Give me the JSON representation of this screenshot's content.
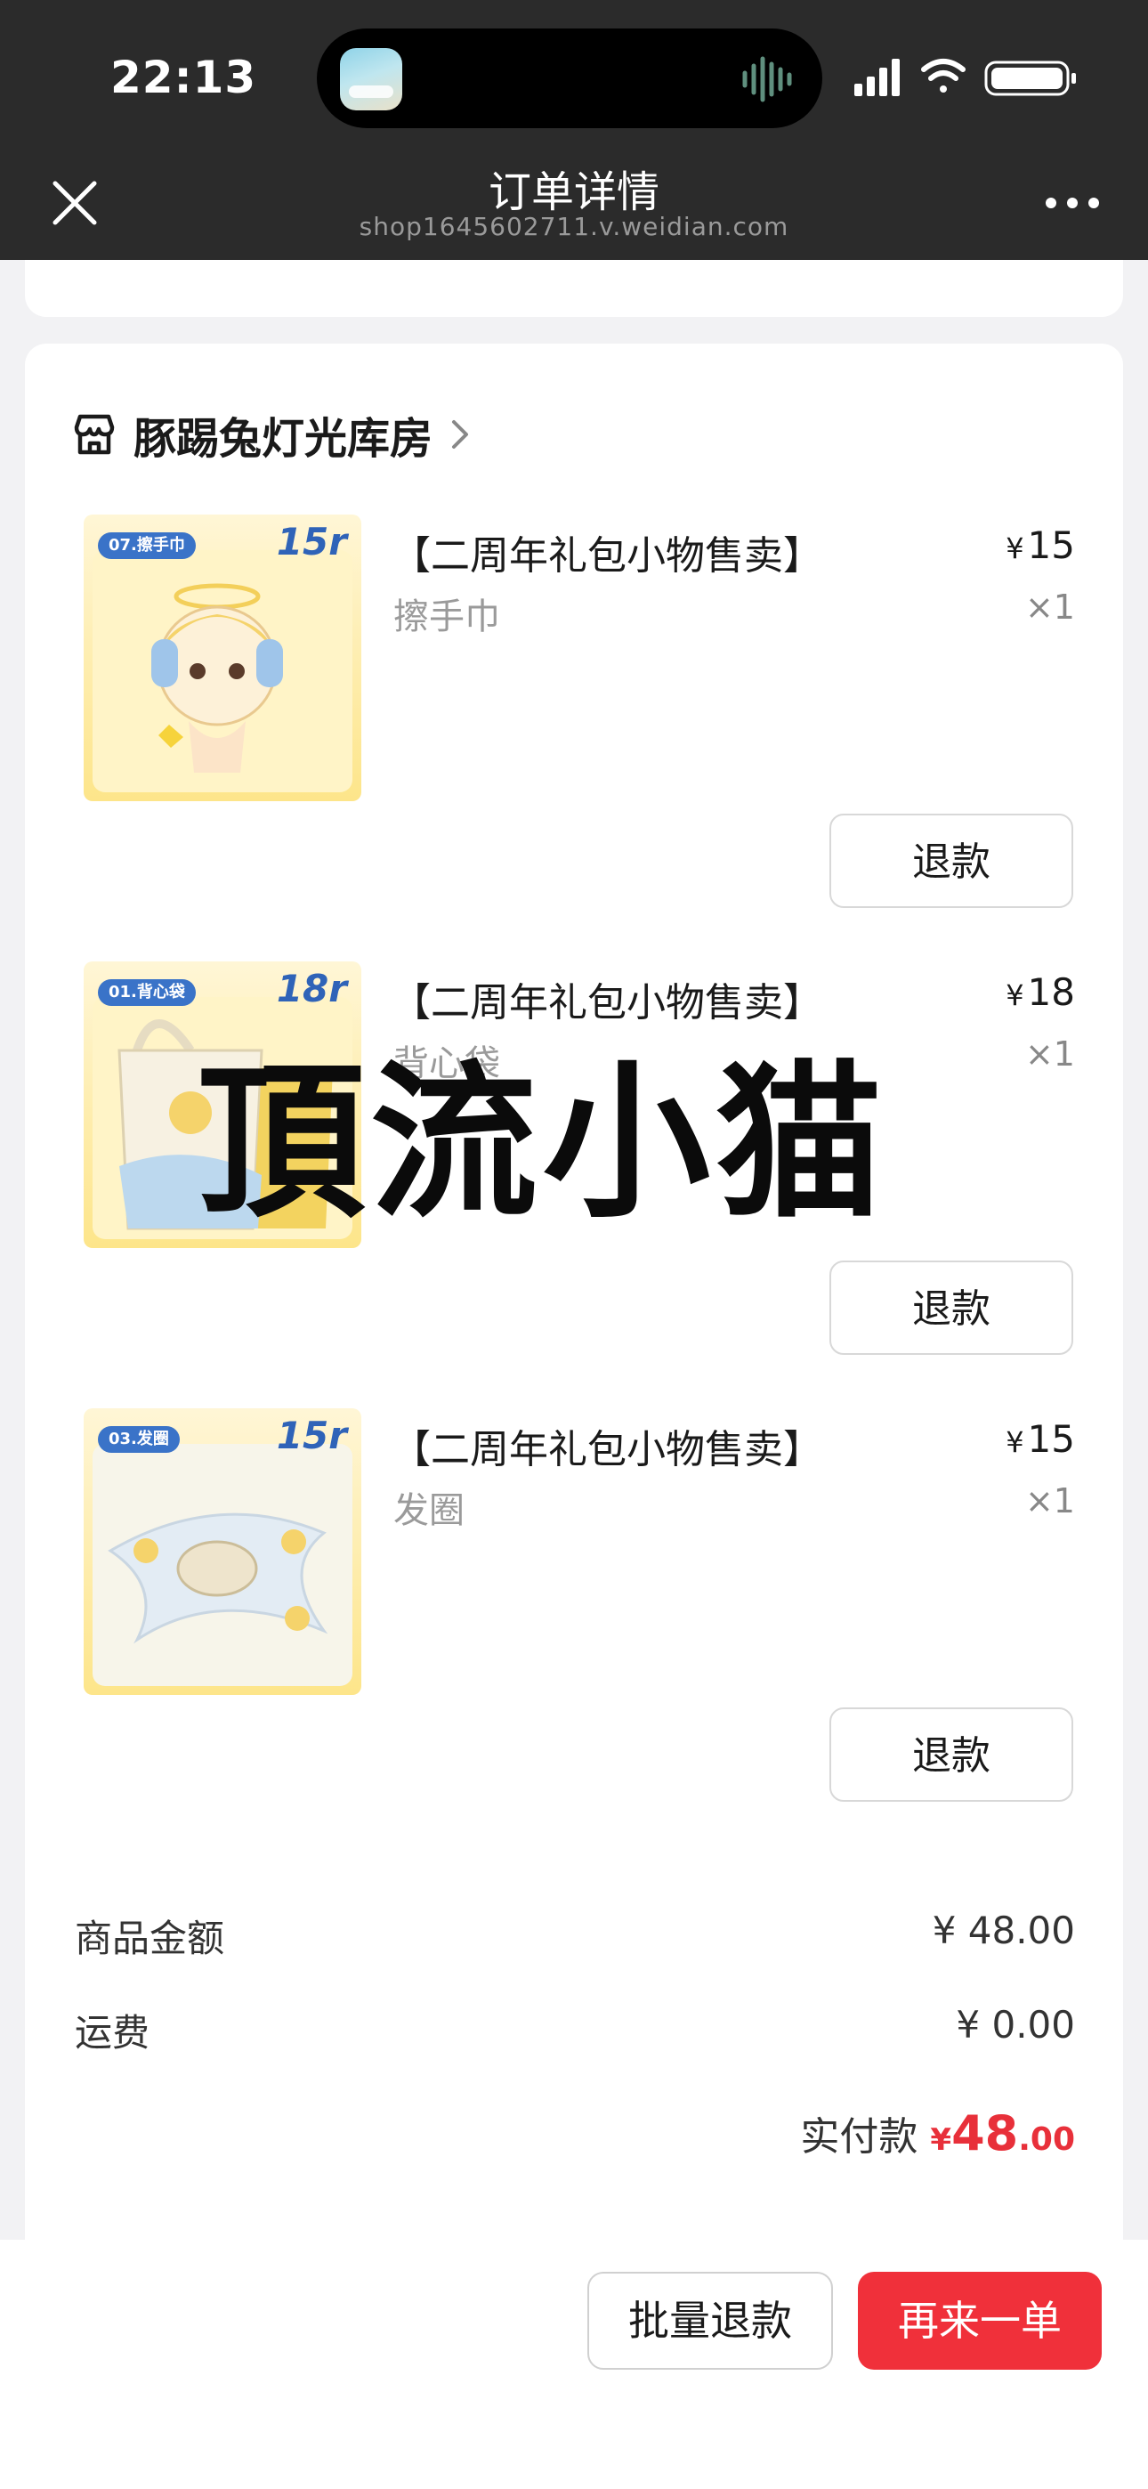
{
  "status_bar": {
    "time": "22:13"
  },
  "nav": {
    "title": "订单详情",
    "subtitle": "shop1645602711.v.weidian.com"
  },
  "shop": {
    "name": "豚踢兔灯光库房"
  },
  "items": [
    {
      "title": "【二周年礼包小物售卖】",
      "variant": "擦手巾",
      "price_symbol": "¥",
      "price": "15",
      "qty": "×1",
      "refund_label": "退款",
      "thumb_tag": "07.擦手巾",
      "thumb_price": "15r"
    },
    {
      "title": "【二周年礼包小物售卖】",
      "variant": "背心袋",
      "price_symbol": "¥",
      "price": "18",
      "qty": "×1",
      "refund_label": "退款",
      "thumb_tag": "01.背心袋",
      "thumb_price": "18r"
    },
    {
      "title": "【二周年礼包小物售卖】",
      "variant": "发圈",
      "price_symbol": "¥",
      "price": "15",
      "qty": "×1",
      "refund_label": "退款",
      "thumb_tag": "03.发圈",
      "thumb_price": "15r"
    }
  ],
  "summary": {
    "goods_label": "商品金额",
    "goods_value": "¥ 48.00",
    "shipping_label": "运费",
    "shipping_value": "¥ 0.00",
    "paid_label": "实付款",
    "paid_symbol": "¥",
    "paid_int": "48",
    "paid_dec": ".00"
  },
  "watermark": {
    "text": "頂流小猫"
  },
  "actions": {
    "batch_refund": "批量退款",
    "reorder": "再来一单"
  },
  "colors": {
    "accent": "#f0303a",
    "topbar": "#2b2b2b",
    "thumb_bg": "#fde58a"
  }
}
